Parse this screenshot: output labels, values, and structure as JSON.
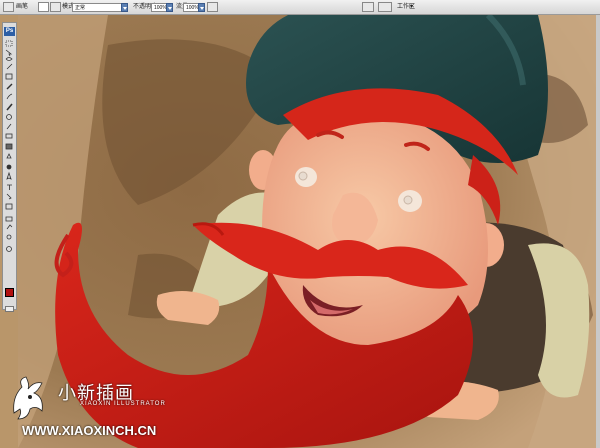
{
  "options_bar": {
    "brush_label": "画笔",
    "mode_label": "模式",
    "mode_value": "正常",
    "opacity_label": "不透明度",
    "opacity_value": "100%",
    "flow_label": "流量",
    "flow_value": "100%",
    "workspace_label": "工作区"
  },
  "toolbox": {
    "logo": "Ps",
    "foreground_color": "#b01010",
    "background_color": "#ffffff"
  },
  "watermark": {
    "name_cn": "小新插画",
    "subtitle": "XIAOXIN ILLUSTRATOR",
    "url": "WWW.XIAOXINCH.CN"
  }
}
